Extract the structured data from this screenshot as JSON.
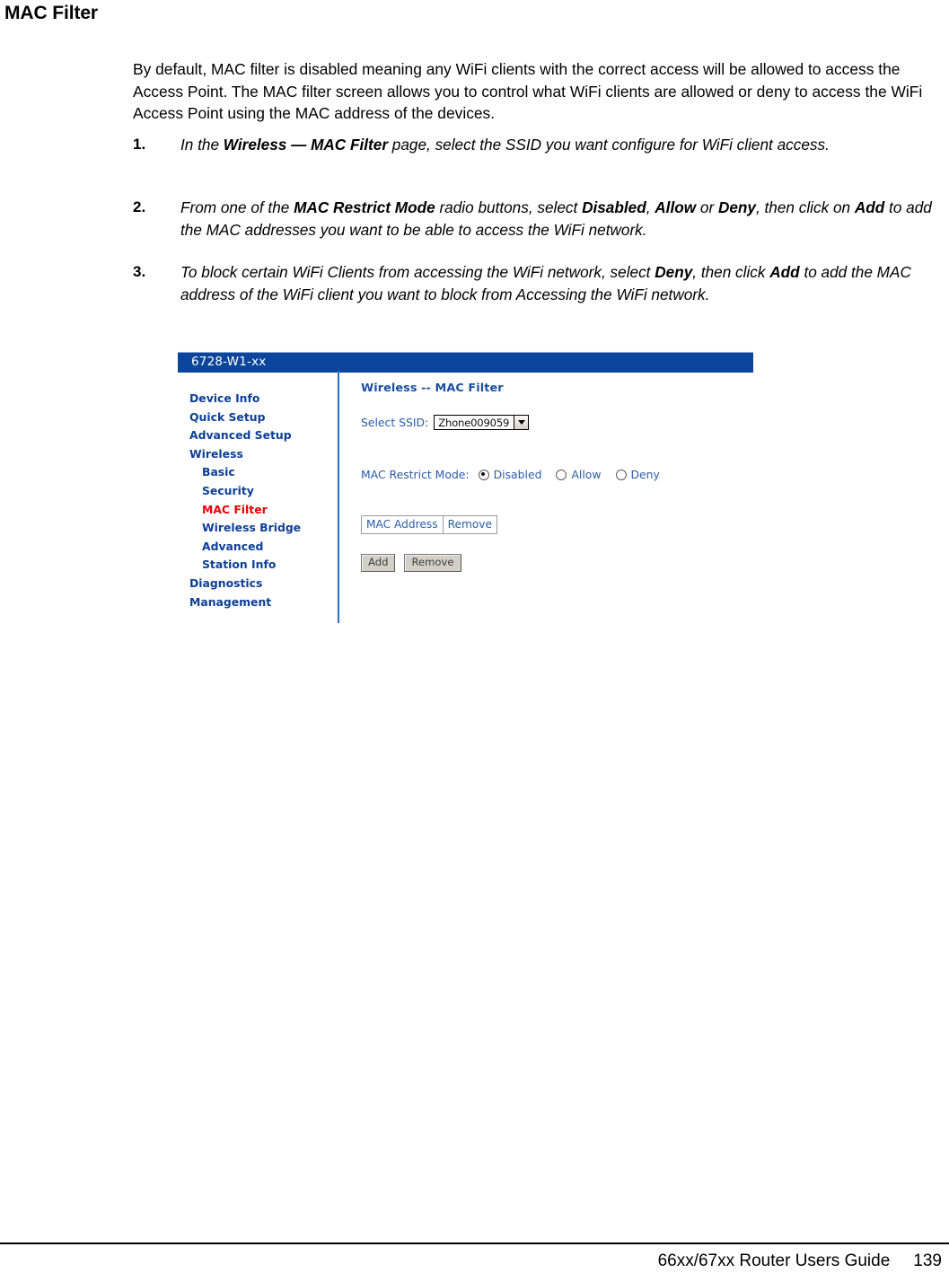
{
  "page": {
    "heading": "MAC Filter",
    "intro": "By default, MAC filter is disabled meaning any WiFi clients with the correct access will be allowed to access the Access Point.  The MAC filter screen allows you to control what WiFi clients are allowed or deny to access the WiFi Access Point using the MAC address of the devices."
  },
  "steps": [
    {
      "number": "1.",
      "parts": [
        {
          "text": "In the ",
          "bold": false
        },
        {
          "text": "Wireless — MAC Filter",
          "bold": true
        },
        {
          "text": " page, select the SSID you want configure for WiFi client access.",
          "bold": false
        }
      ]
    },
    {
      "number": "2.",
      "parts": [
        {
          "text": "From one of the ",
          "bold": false
        },
        {
          "text": "MAC Restrict Mode",
          "bold": true
        },
        {
          "text": " radio buttons, select ",
          "bold": false
        },
        {
          "text": "Disabled",
          "bold": true
        },
        {
          "text": ", ",
          "bold": false
        },
        {
          "text": "Allow",
          "bold": true
        },
        {
          "text": " or ",
          "bold": false
        },
        {
          "text": "Deny",
          "bold": true
        },
        {
          "text": ", then click on ",
          "bold": false
        },
        {
          "text": "Add",
          "bold": true
        },
        {
          "text": " to add the MAC addresses you want to be able to access the WiFi network.",
          "bold": false
        }
      ]
    },
    {
      "number": "3.",
      "parts": [
        {
          "text": "To block certain WiFi Clients from accessing the WiFi network, select ",
          "bold": false
        },
        {
          "text": "Deny",
          "bold": true
        },
        {
          "text": ", then click ",
          "bold": false
        },
        {
          "text": "Add",
          "bold": true
        },
        {
          "text": " to add the MAC address of the WiFi client you want to block from Accessing the WiFi network.",
          "bold": false
        }
      ]
    }
  ],
  "router_ui": {
    "titlebar": {
      "text": "6728-W1-xx",
      "bg_color": "#0b469c",
      "text_color": "#ffffff"
    },
    "nav": {
      "link_color": "#0d3f96",
      "active_color": "#ee0000",
      "items": [
        {
          "label": "Device Info",
          "indent": false,
          "active": false
        },
        {
          "label": "Quick Setup",
          "indent": false,
          "active": false
        },
        {
          "label": "Advanced Setup",
          "indent": false,
          "active": false
        },
        {
          "label": "Wireless",
          "indent": false,
          "active": false
        },
        {
          "label": "Basic",
          "indent": true,
          "active": false
        },
        {
          "label": "Security",
          "indent": true,
          "active": false
        },
        {
          "label": "MAC Filter",
          "indent": true,
          "active": true
        },
        {
          "label": "Wireless Bridge",
          "indent": true,
          "active": false
        },
        {
          "label": "Advanced",
          "indent": true,
          "active": false
        },
        {
          "label": "Station Info",
          "indent": true,
          "active": false
        },
        {
          "label": "Diagnostics",
          "indent": false,
          "active": false
        },
        {
          "label": "Management",
          "indent": false,
          "active": false
        }
      ]
    },
    "main": {
      "heading": "Wireless -- MAC Filter",
      "ssid": {
        "label": "Select SSID:",
        "selected": "Zhone009059",
        "options": [
          "Zhone009059"
        ]
      },
      "restrict_mode": {
        "label": "MAC Restrict Mode:",
        "options": [
          {
            "label": "Disabled",
            "checked": true
          },
          {
            "label": "Allow",
            "checked": false
          },
          {
            "label": "Deny",
            "checked": false
          }
        ]
      },
      "mac_table": {
        "headers": [
          "MAC Address",
          "Remove"
        ],
        "rows": []
      },
      "buttons": [
        {
          "label": "Add"
        },
        {
          "label": "Remove"
        }
      ]
    }
  },
  "footer": {
    "guide": "66xx/67xx Router Users Guide",
    "page_number": "139"
  }
}
